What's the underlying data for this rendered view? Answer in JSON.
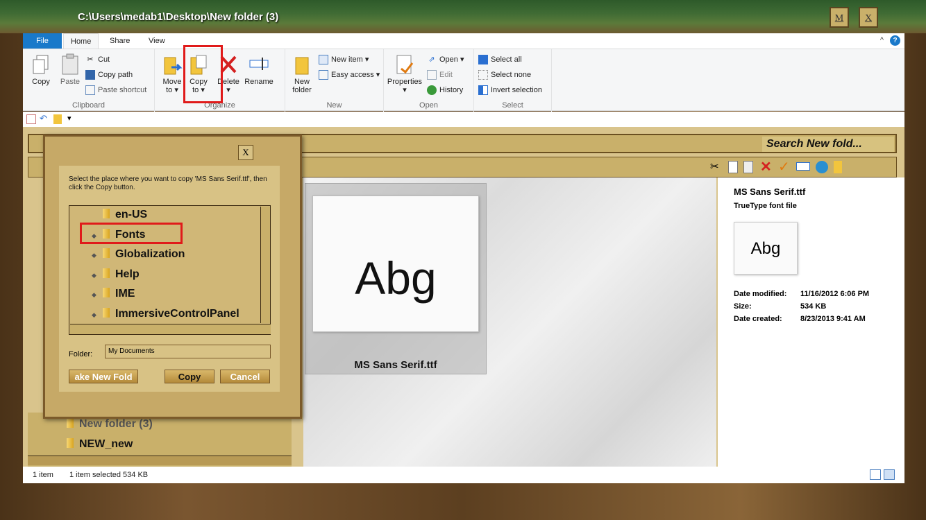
{
  "window": {
    "title": "C:\\Users\\medab1\\Desktop\\New folder (3)",
    "min_label": "M",
    "close_label": "X"
  },
  "ribbon": {
    "tabs": [
      "File",
      "Home",
      "Share",
      "View"
    ],
    "clipboard": {
      "label": "Clipboard",
      "copy": "Copy",
      "paste": "Paste",
      "cut": "Cut",
      "copy_path": "Copy path",
      "paste_shortcut": "Paste shortcut"
    },
    "organize": {
      "label": "Organize",
      "move_to": "Move to",
      "copy_to": "Copy to",
      "delete": "Delete",
      "rename": "Rename"
    },
    "new": {
      "label": "New",
      "new_folder": "New folder",
      "new_item": "New item",
      "easy_access": "Easy access"
    },
    "open": {
      "label": "Open",
      "properties": "Properties",
      "open": "Open",
      "edit": "Edit",
      "history": "History"
    },
    "select": {
      "label": "Select",
      "select_all": "Select all",
      "select_none": "Select none",
      "invert": "Invert selection"
    }
  },
  "search": {
    "placeholder": "Search New fold..."
  },
  "preview": {
    "glyph": "Abg",
    "filename": "MS Sans Serif.ttf"
  },
  "details": {
    "name": "MS Sans Serif.ttf",
    "type": "TrueType font file",
    "glyph": "Abg",
    "date_modified_label": "Date modified:",
    "date_modified": "11/16/2012 6:06 PM",
    "size_label": "Size:",
    "size": "534 KB",
    "date_created_label": "Date created:",
    "date_created": "8/23/2013 9:41 AM"
  },
  "nav": {
    "items": [
      "New folder (3)",
      "NEW_new"
    ]
  },
  "status": {
    "count": "1 item",
    "selected": "1 item selected  534 KB"
  },
  "dialog": {
    "close": "X",
    "instruction": "Select the place where you want to copy 'MS Sans Serif.ttf', then click the Copy button.",
    "tree": [
      "en-US",
      "Fonts",
      "Globalization",
      "Help",
      "IME",
      "ImmersiveControlPanel"
    ],
    "folder_label": "Folder:",
    "folder_value": "My Documents",
    "make_new_folder": "ake New Fold",
    "copy": "Copy",
    "cancel": "Cancel"
  }
}
